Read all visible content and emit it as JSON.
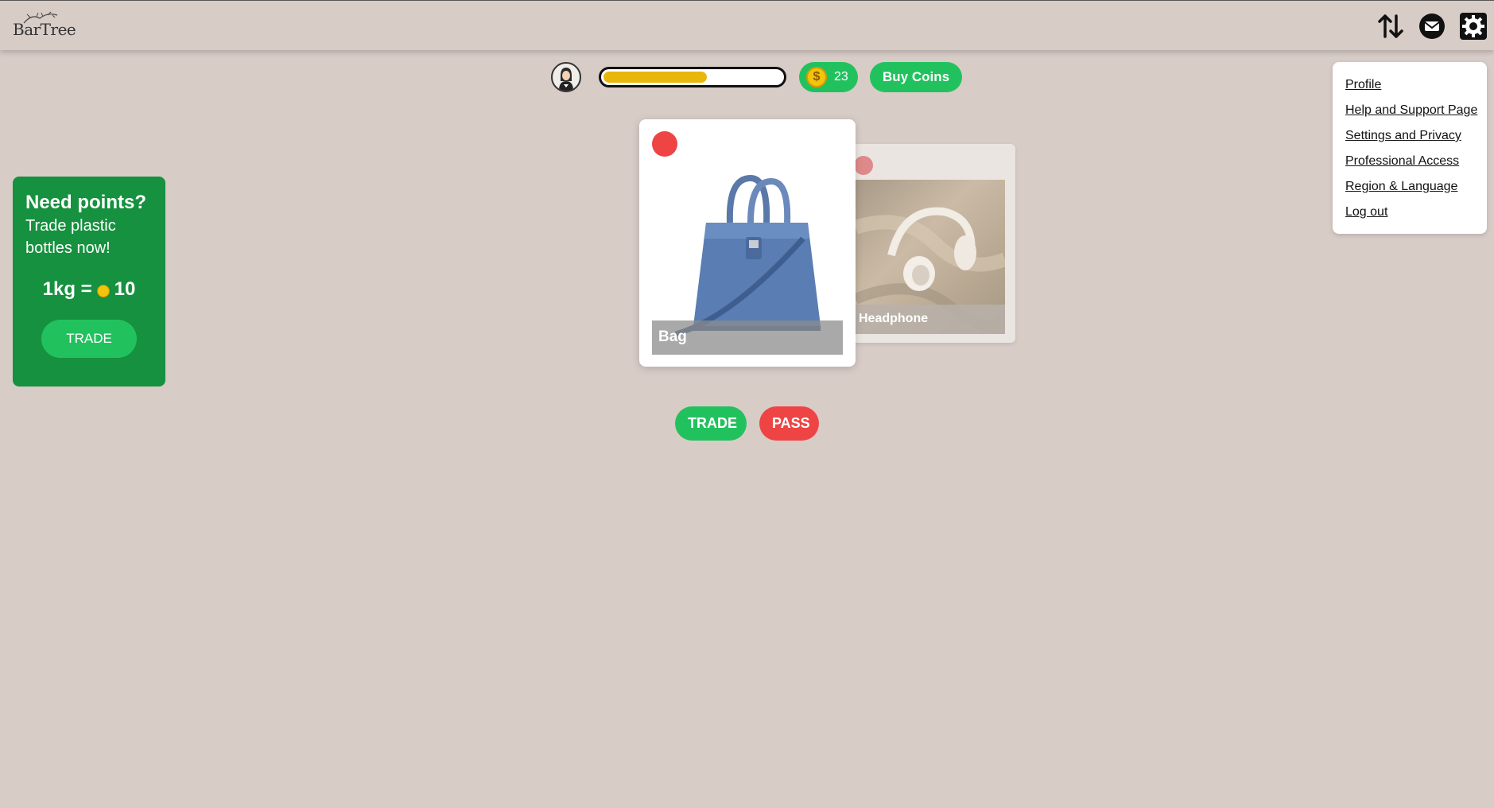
{
  "header": {
    "logo_text": "BarTree"
  },
  "status": {
    "progress_fraction": 0.58,
    "coin_symbol": "$",
    "coin_count": "23",
    "buy_coins_label": "Buy Coins"
  },
  "menu": {
    "items": [
      {
        "label": "Profile"
      },
      {
        "label": "Help and Support Page"
      },
      {
        "label": "Settings and Privacy"
      },
      {
        "label": "Professional Access"
      },
      {
        "label": "Region & Language"
      },
      {
        "label": "Log out"
      }
    ]
  },
  "promo": {
    "title": "Need points?",
    "text": "Trade plastic bottles now!",
    "rate_left": "1kg =",
    "rate_right": "10",
    "button_label": "TRADE"
  },
  "cards": {
    "front_label": "Bag",
    "back_label": "Headphone"
  },
  "actions": {
    "trade_label": "TRADE",
    "pass_label": "PASS"
  },
  "colors": {
    "background": "#d8ccc7",
    "accent_green": "#21c25e",
    "promo_green": "#16913f",
    "pass_red": "#ef4444",
    "progress_yellow": "#e9b60c"
  },
  "icons": [
    "sort-arrows-icon",
    "mail-icon",
    "gear-icon",
    "dollar-coin-icon",
    "avatar-icon"
  ]
}
